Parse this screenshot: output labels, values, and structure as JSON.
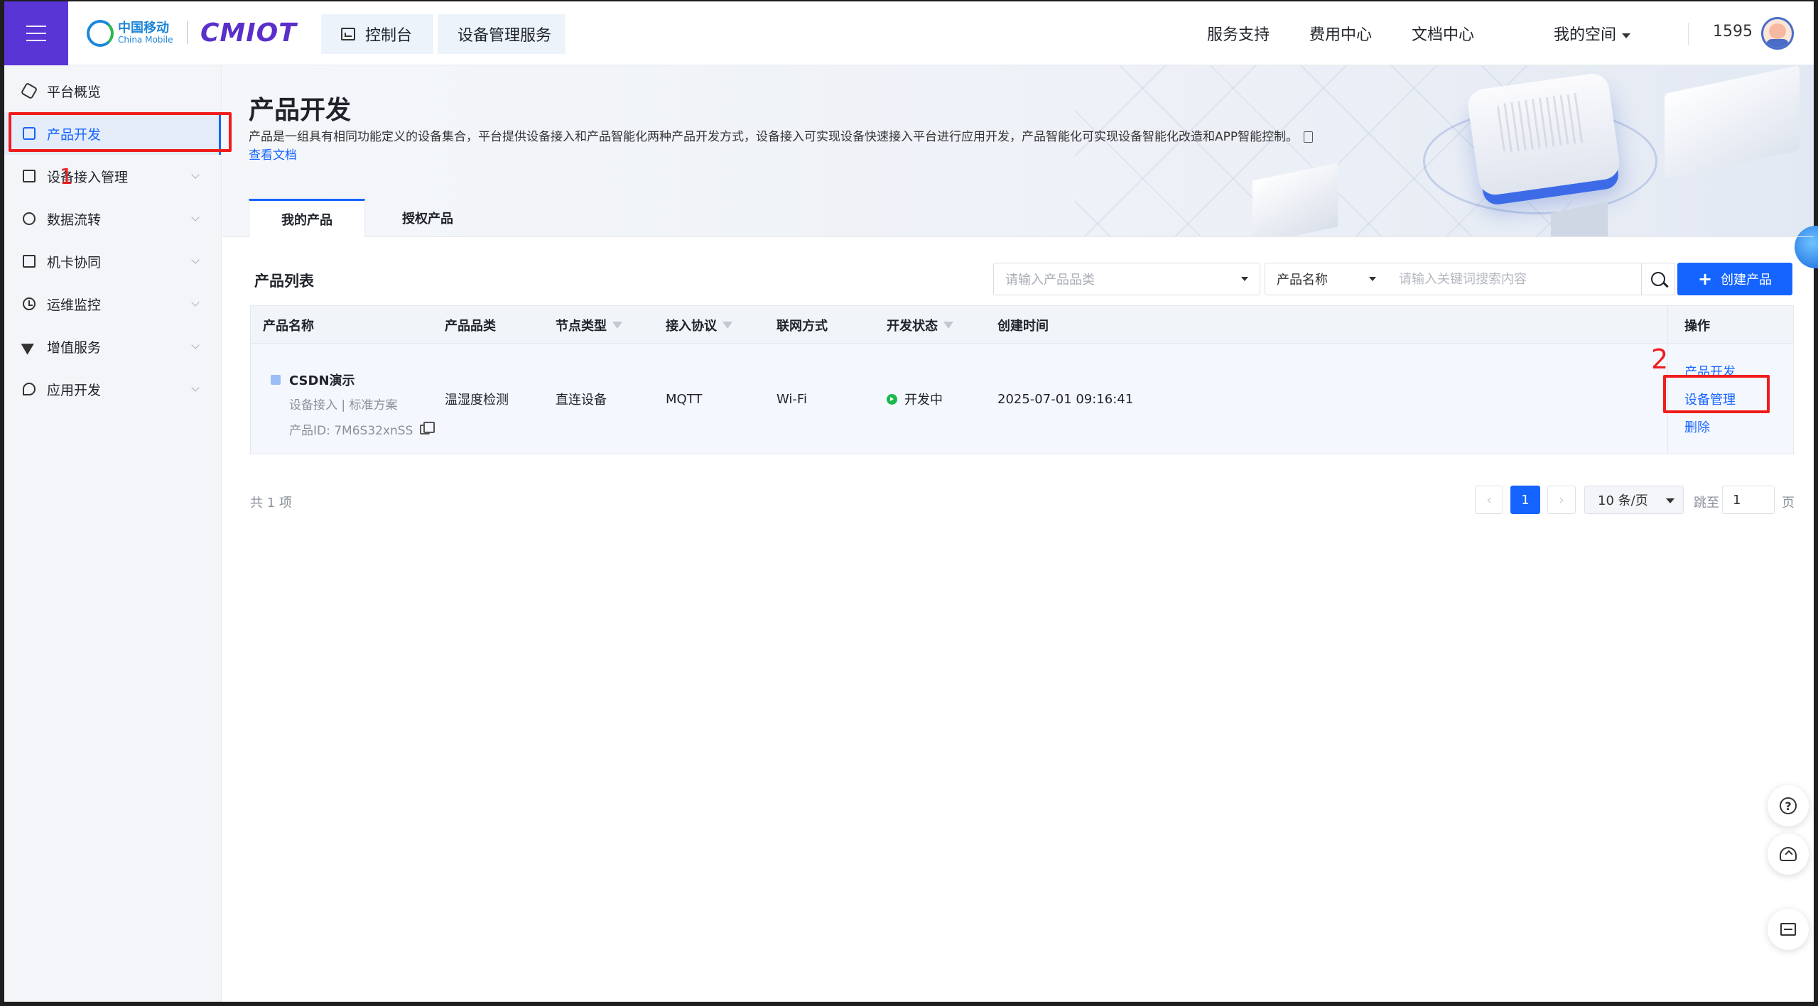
{
  "header": {
    "logo_cn": "中国移动",
    "logo_en": "China Mobile",
    "logo_cmiot": "CMIOT",
    "breadcrumb": [
      "控制台",
      "设备管理服务"
    ],
    "nav_links": [
      "服务支持",
      "费用中心",
      "文档中心",
      "我的空间"
    ],
    "user_id": "1595"
  },
  "sidebar": {
    "items": [
      {
        "label": "平台概览",
        "icon": "platform-overview-icon",
        "expandable": false
      },
      {
        "label": "产品开发",
        "icon": "product-cube-icon",
        "expandable": false,
        "active": true
      },
      {
        "label": "设备接入管理",
        "icon": "device-access-icon",
        "expandable": true
      },
      {
        "label": "数据流转",
        "icon": "data-flow-icon",
        "expandable": true
      },
      {
        "label": "机卡协同",
        "icon": "card-sync-icon",
        "expandable": true
      },
      {
        "label": "运维监控",
        "icon": "monitor-clock-icon",
        "expandable": true
      },
      {
        "label": "增值服务",
        "icon": "value-added-icon",
        "expandable": true
      },
      {
        "label": "应用开发",
        "icon": "app-dev-icon",
        "expandable": true
      }
    ]
  },
  "annotations": {
    "num1": "1",
    "num2": "2"
  },
  "page": {
    "title": "产品开发",
    "description": "产品是一组具有相同功能定义的设备集合，平台提供设备接入和产品智能化两种产品开发方式，设备接入可实现设备快速接入平台进行应用开发，产品智能化可实现设备智能化改造和APP智能控制。",
    "doc_link": "查看文档",
    "tabs": [
      "我的产品",
      "授权产品"
    ]
  },
  "list": {
    "title": "产品列表",
    "category_placeholder": "请输入产品品类",
    "search_field": "产品名称",
    "keyword_placeholder": "请输入关键词搜索内容",
    "create_label": "创建产品",
    "columns": [
      "产品名称",
      "产品品类",
      "节点类型",
      "接入协议",
      "联网方式",
      "开发状态",
      "创建时间",
      "操作"
    ],
    "rows": [
      {
        "name": "CSDN演示",
        "sub": "设备接入  |  标准方案",
        "product_id": "产品ID:  7M6S32xnSS",
        "category": "温湿度检测",
        "node_type": "直连设备",
        "protocol": "MQTT",
        "network": "Wi-Fi",
        "status": "开发中",
        "created": "2025-07-01 09:16:41",
        "actions": [
          "产品开发",
          "设备管理",
          "删除"
        ]
      }
    ]
  },
  "pagination": {
    "total": "共 1 项",
    "prev": "‹",
    "current": "1",
    "next": "›",
    "page_size": "10 条/页",
    "jump_label": "跳至",
    "jump_value": "1",
    "page_label": "页"
  },
  "colors": {
    "primary": "#1664ff",
    "brand_purple": "#5a35d6",
    "annotation_red": "#f01c1c",
    "status_green": "#1ab84d"
  }
}
